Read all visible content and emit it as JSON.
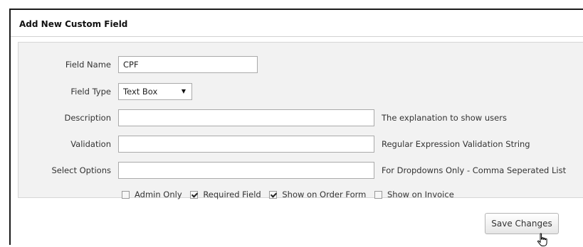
{
  "panel": {
    "title": "Add New Custom Field"
  },
  "fields": {
    "field_name": {
      "label": "Field Name",
      "value": "CPF"
    },
    "field_type": {
      "label": "Field Type",
      "selected": "Text Box",
      "arrow_icon": "dropdown-arrow-icon"
    },
    "description": {
      "label": "Description",
      "value": "",
      "helper": "The explanation to show users"
    },
    "validation": {
      "label": "Validation",
      "value": "",
      "helper": "Regular Expression Validation String"
    },
    "select_options": {
      "label": "Select Options",
      "value": "",
      "helper": "For Dropdowns Only - Comma Seperated List"
    }
  },
  "options": [
    {
      "label": "Admin Only",
      "checked": false
    },
    {
      "label": "Required Field",
      "checked": true
    },
    {
      "label": "Show on Order Form",
      "checked": true
    },
    {
      "label": "Show on Invoice",
      "checked": false
    }
  ],
  "actions": {
    "save_label": "Save Changes"
  },
  "cursor": {
    "icon": "hand-pointer-icon"
  }
}
